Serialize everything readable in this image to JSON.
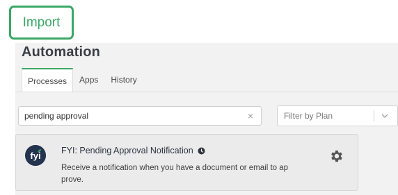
{
  "callout": {
    "label": "Import"
  },
  "header": {
    "title": "Automation"
  },
  "tabs": [
    {
      "label": "Processes",
      "active": true
    },
    {
      "label": "Apps",
      "active": false
    },
    {
      "label": "History",
      "active": false
    }
  ],
  "search": {
    "value": "pending approval",
    "clear_icon": "close-icon"
  },
  "filter": {
    "placeholder": "Filter by Plan",
    "icon": "chevron-down-icon"
  },
  "process": {
    "title": "FYI: Pending Approval Notification",
    "description_line1": "Receive a notification when you have a document or email to ap",
    "description_line2": "prove.",
    "logo_icon": "fyi-logo-icon",
    "info_icon": "info-icon",
    "settings_icon": "gear-icon"
  },
  "colors": {
    "accent": "#3aa765",
    "logo": "#24344f",
    "panel": "#f2f2f2",
    "card": "#ebebeb"
  }
}
